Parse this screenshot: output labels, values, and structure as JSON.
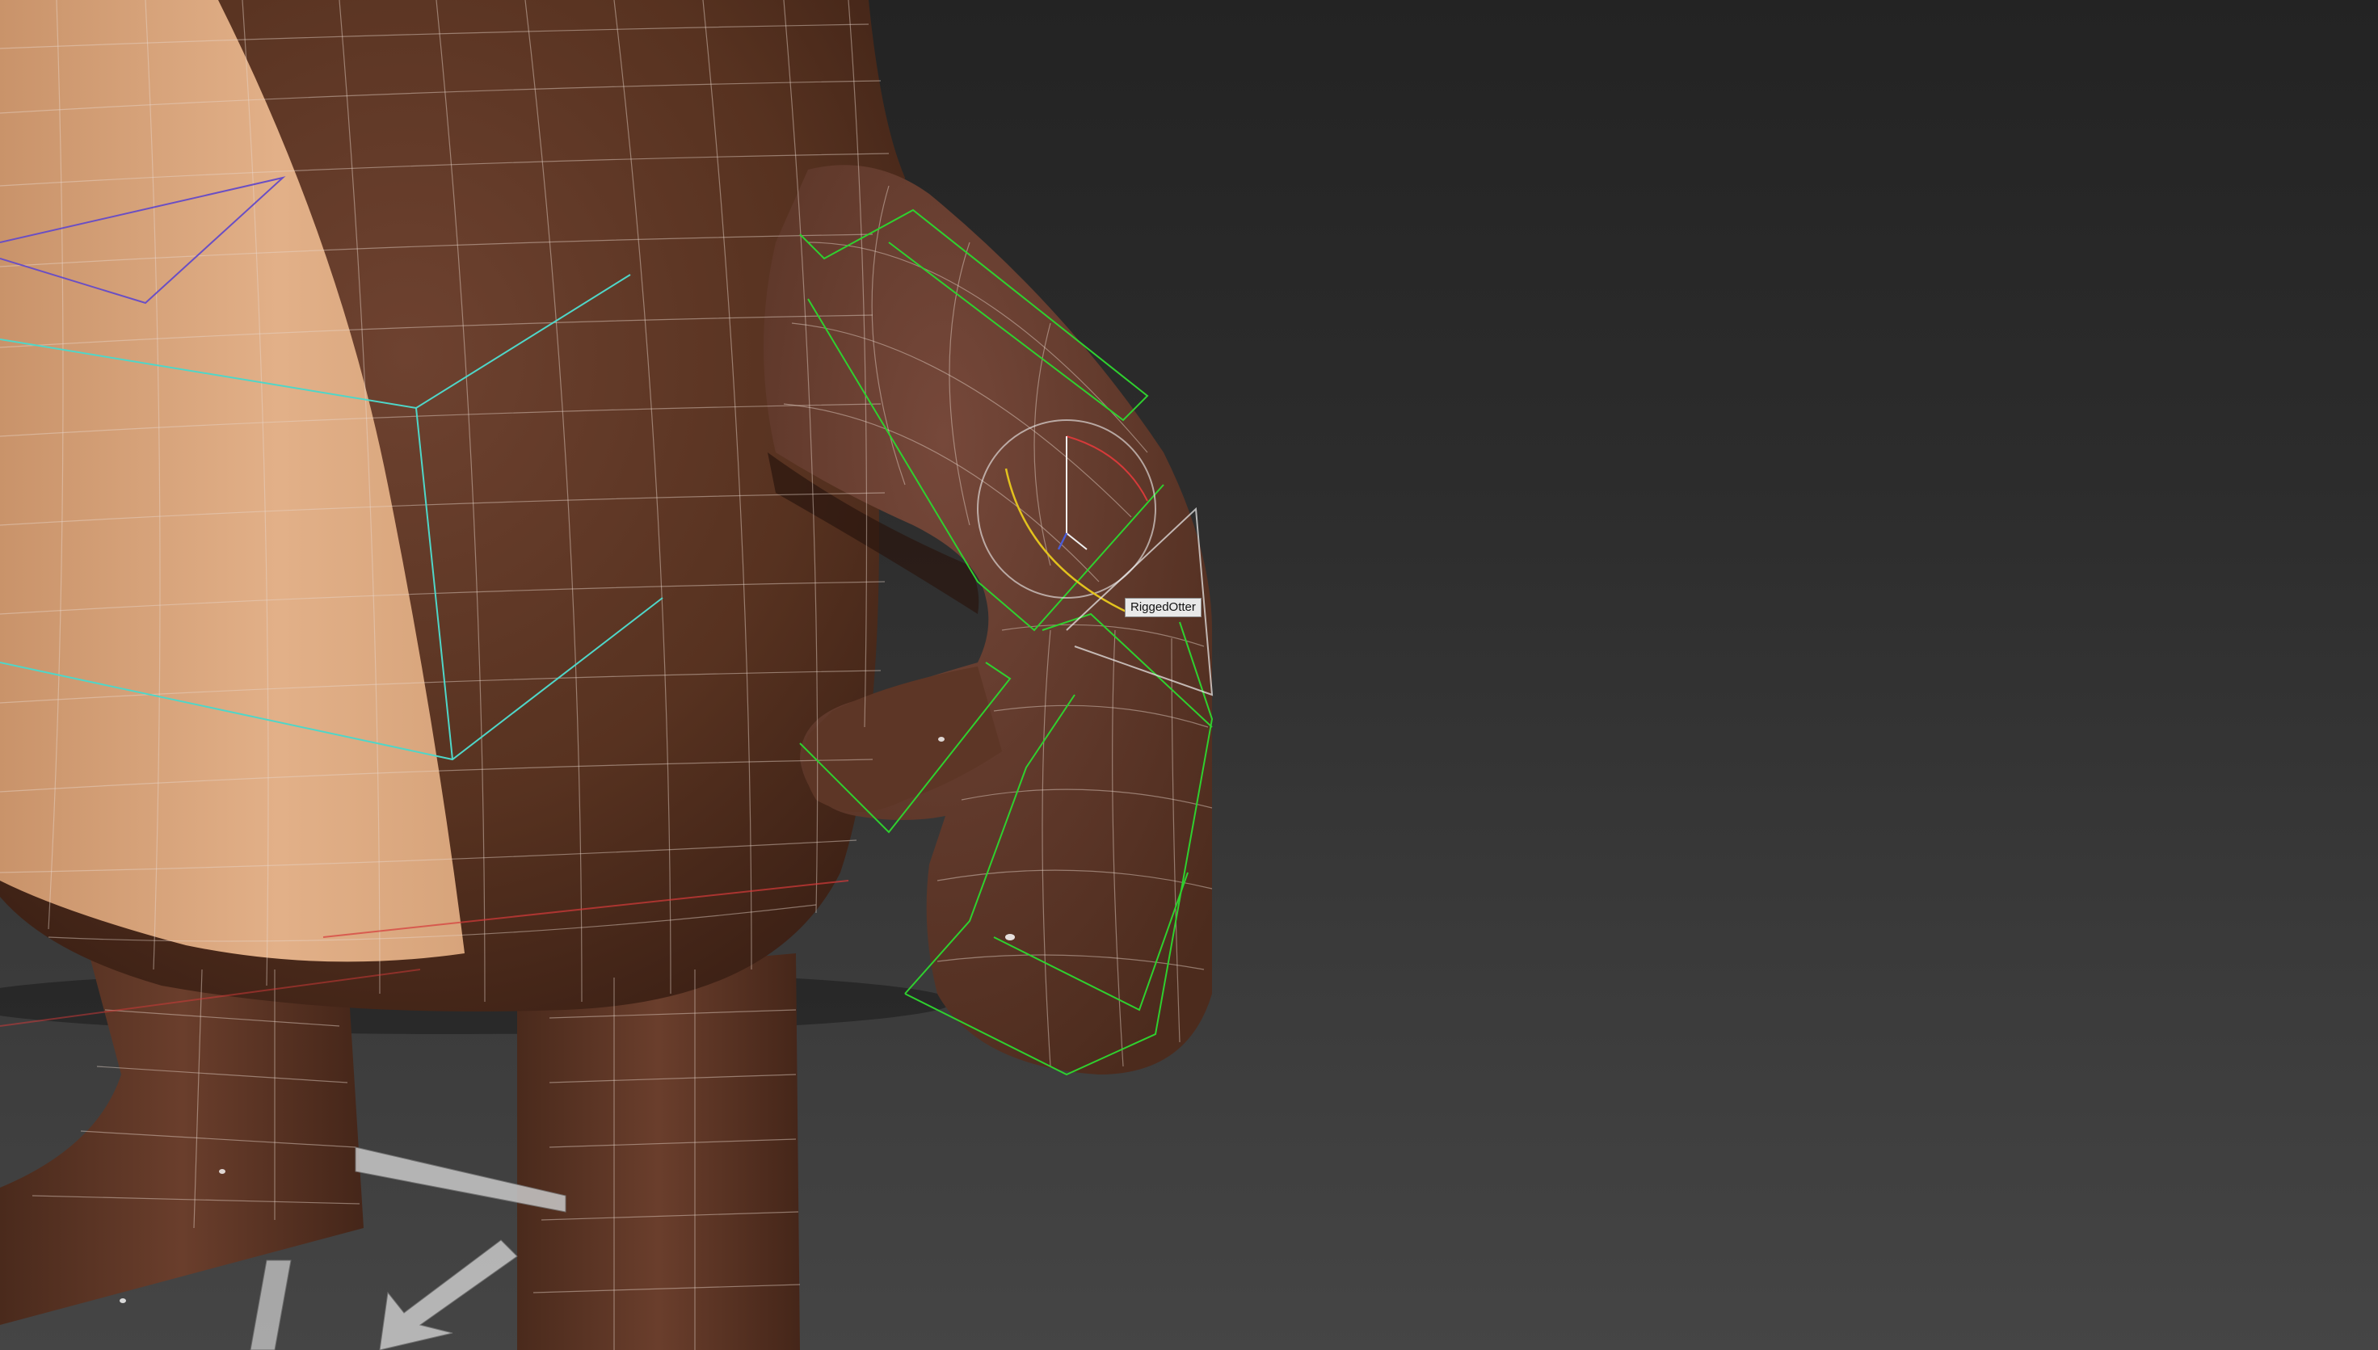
{
  "viewport": {
    "object_tooltip": "RiggedOtter",
    "colors": {
      "background_top": "#232323",
      "background_bottom": "#454545",
      "body_brown": "#5a3424",
      "belly_tan": "#d9a57c",
      "wireframe": "#e8d8cc",
      "rig_green": "#2fd02f",
      "rig_cyan": "#4fd6c8",
      "rig_purple": "#6a4fc4",
      "gizmo_white": "#f0f0f0"
    }
  }
}
